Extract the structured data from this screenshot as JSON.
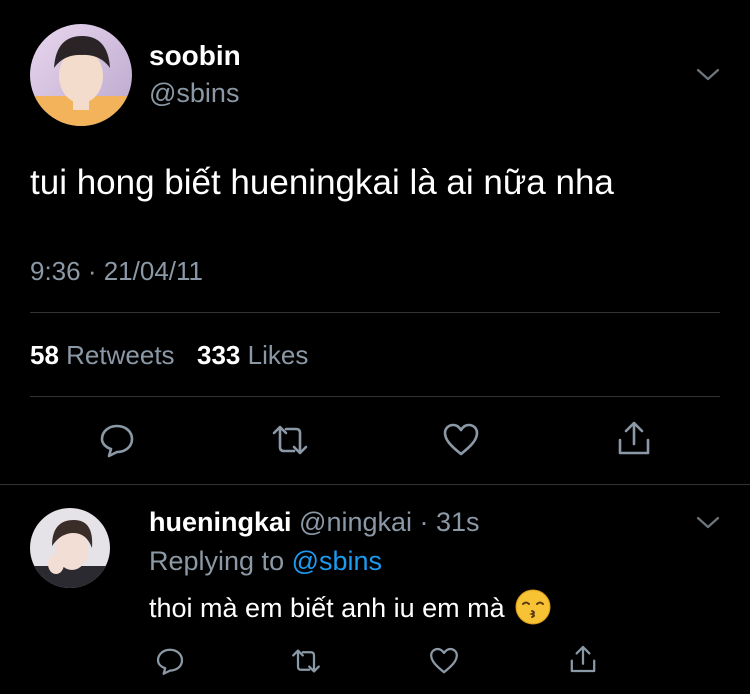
{
  "tweet": {
    "author": {
      "display_name": "soobin",
      "handle": "@sbins"
    },
    "text": "tui hong biết hueningkai là ai nữa nha",
    "timestamp": "9:36 · 21/04/11",
    "stats": {
      "retweets_count": "58",
      "retweets_label": "Retweets",
      "likes_count": "333",
      "likes_label": "Likes"
    },
    "actions": [
      "reply-icon",
      "retweet-icon",
      "like-icon",
      "share-icon"
    ]
  },
  "reply": {
    "author": {
      "display_name": "hueningkai",
      "handle": "@ningkai",
      "time_ago": "· 31s"
    },
    "replying_prefix": "Replying to",
    "replying_mention": "@sbins",
    "text": "thoi mà em biết anh iu em mà",
    "emoji": "kissing-face-emoji",
    "actions": [
      "reply-icon",
      "retweet-icon",
      "like-icon",
      "share-icon"
    ]
  },
  "colors": {
    "background": "#000000",
    "primary_text": "#ffffff",
    "secondary_text": "#8b98a5",
    "link": "#1d9bf0",
    "divider": "#2f3336"
  }
}
